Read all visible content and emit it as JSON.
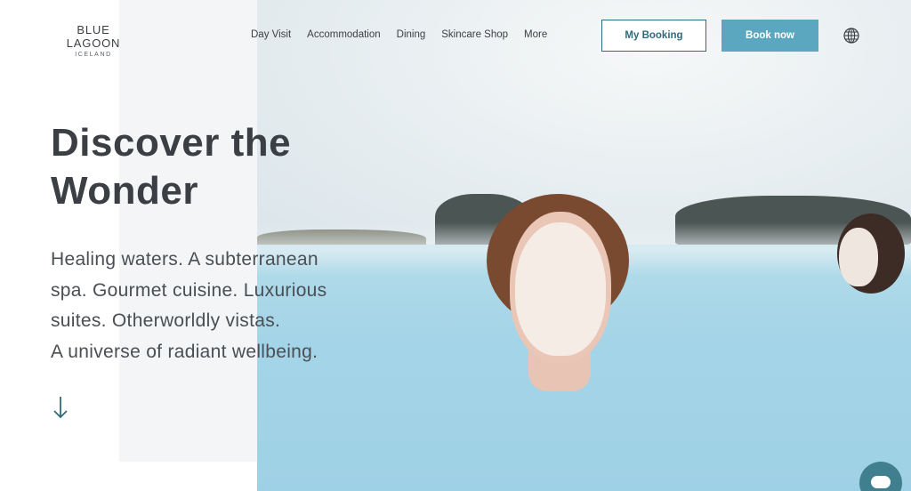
{
  "logo": {
    "main": "BLUE LAGOON",
    "sub": "ICELAND"
  },
  "nav": {
    "items": [
      {
        "label": "Day Visit"
      },
      {
        "label": "Accommodation"
      },
      {
        "label": "Dining"
      },
      {
        "label": "Skincare Shop"
      },
      {
        "label": "More"
      }
    ]
  },
  "header_actions": {
    "my_booking_label": "My Booking",
    "book_now_label": "Book now",
    "language_icon": "globe-icon"
  },
  "hero": {
    "title_line1": "Discover the",
    "title_line2": "Wonder",
    "body_lines": [
      "Healing waters. A subterranean",
      "spa. Gourmet cuisine. Luxurious",
      "suites. Otherworldly vistas.",
      "A universe of radiant wellbeing."
    ],
    "scroll_icon": "arrow-down-icon"
  },
  "chat": {
    "icon": "chat-bubble-icon"
  },
  "colors": {
    "primary_text": "#3b3f44",
    "accent_teal": "#5ba7bf",
    "button_outline": "#2f6b7d",
    "panel_bg": "#f3f5f7"
  }
}
